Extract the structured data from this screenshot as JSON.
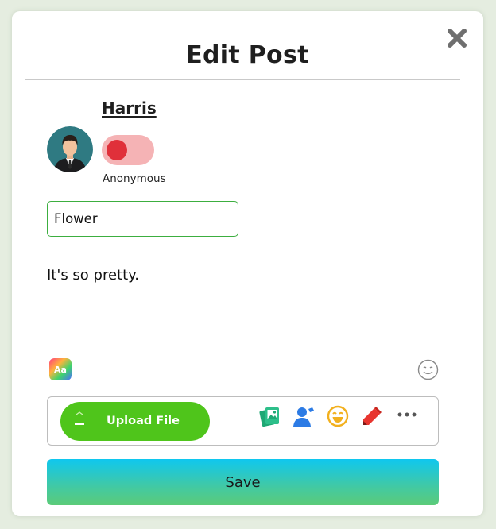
{
  "dialog": {
    "title": "Edit Post"
  },
  "author": {
    "name": "Harris",
    "anonymous_label": "Anonymous",
    "anonymous_toggle": "off"
  },
  "post": {
    "title_value": "Flower",
    "body": "It's so pretty."
  },
  "toolbar": {
    "upload_label": "Upload File",
    "icons": [
      "photo-gallery-icon",
      "tag-person-icon",
      "feeling-emoji-icon",
      "draw-pen-icon",
      "more-options-icon"
    ]
  },
  "actions": {
    "save_label": "Save"
  },
  "format_button_label": "Aa",
  "colors": {
    "background": "#e5ede0",
    "input_border": "#3cae3f",
    "toggle_track": "#f5b3b5",
    "toggle_knob": "#e0303a",
    "upload_button": "#4fc51b",
    "save_gradient_top": "#0fc7ef",
    "save_gradient_bottom": "#5ccb78"
  }
}
